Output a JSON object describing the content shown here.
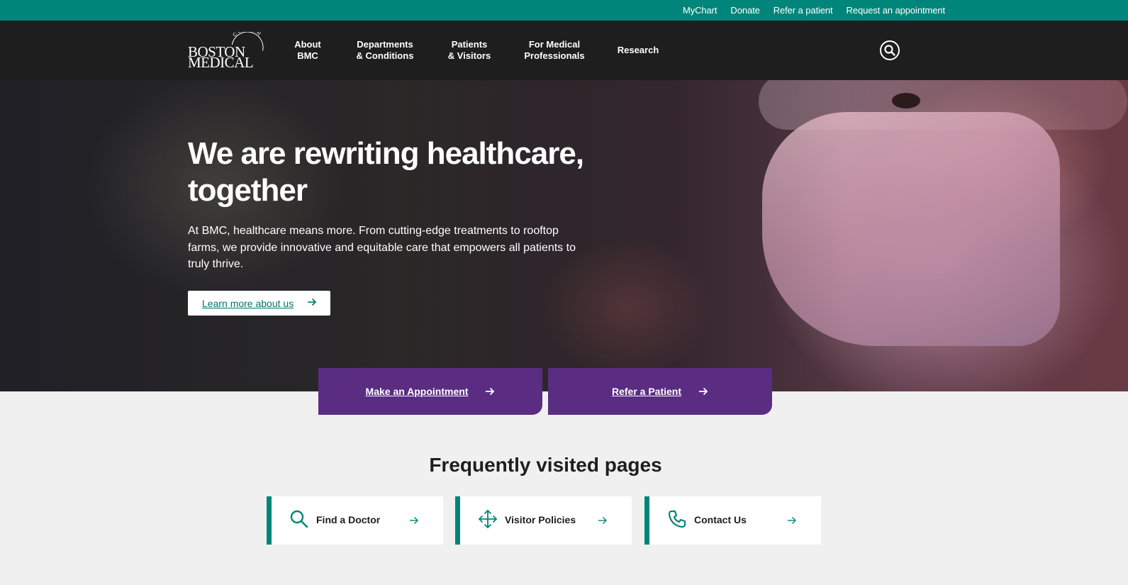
{
  "utility_nav": {
    "links": [
      "MyChart",
      "Donate",
      "Refer a patient",
      "Request an appointment"
    ]
  },
  "logo": {
    "line1": "BOSTON",
    "line2": "MEDICAL",
    "arc": "CENTER"
  },
  "main_nav": {
    "items": [
      {
        "line1": "About",
        "line2": "BMC"
      },
      {
        "line1": "Departments",
        "line2": "& Conditions"
      },
      {
        "line1": "Patients",
        "line2": "& Visitors"
      },
      {
        "line1": "For Medical",
        "line2": "Professionals"
      },
      {
        "line1": "Research",
        "line2": ""
      }
    ],
    "search_icon": "search-icon"
  },
  "hero": {
    "title": "We are rewriting healthcare, together",
    "text": "At BMC, healthcare means more. From cutting-edge treatments to rooftop farms, we provide innovative and equitable care that empowers all patients to truly thrive.",
    "button_label": "Learn more about us"
  },
  "cta": {
    "appointment": "Make an Appointment",
    "refer": "Refer a Patient"
  },
  "frequently_visited": {
    "title": "Frequently visited pages",
    "cards": [
      {
        "label": "Find a Doctor",
        "icon": "search-icon"
      },
      {
        "label": "Visitor Policies",
        "icon": "move-arrows-icon"
      },
      {
        "label": "Contact Us",
        "icon": "phone-icon"
      }
    ]
  },
  "colors": {
    "teal": "#00857a",
    "header_dark": "#1e1e1e",
    "purple": "#5a2d82",
    "page_bg": "#f0f0f0"
  }
}
